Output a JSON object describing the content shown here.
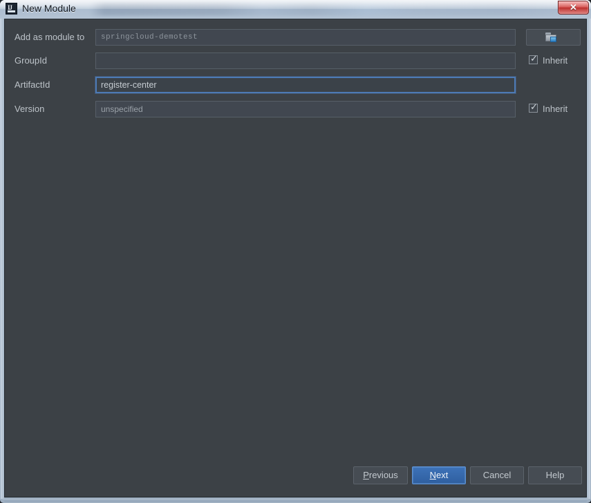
{
  "window": {
    "title": "New Module",
    "app_icon": "intellij-idea-icon",
    "close_label": "✕"
  },
  "form": {
    "rows": [
      {
        "label": "Add as module to",
        "value": "springcloud-demotest",
        "type": "text-disabled",
        "browse_icon": "folder-browse-icon"
      },
      {
        "label": "GroupId",
        "value": "",
        "type": "text-disabled",
        "inherit_label": "Inherit",
        "inherit_checked": true
      },
      {
        "label": "ArtifactId",
        "value": "register-center",
        "type": "text-focused"
      },
      {
        "label": "Version",
        "value": "unspecified",
        "type": "text-disabled",
        "inherit_label": "Inherit",
        "inherit_checked": true
      }
    ]
  },
  "footer": {
    "previous": {
      "prefix": "",
      "mnemonic": "P",
      "suffix": "revious"
    },
    "next": {
      "prefix": "",
      "mnemonic": "N",
      "suffix": "ext"
    },
    "cancel": {
      "label": "Cancel"
    },
    "help": {
      "label": "Help"
    }
  },
  "colors": {
    "dialog_background": "#3c4146",
    "field_border": "#575f68",
    "focus_border": "#4d7ab5",
    "default_button": "#3d72b8",
    "label_text": "#bdc3c9",
    "titlebar_start": "#b9c8d9",
    "close_button": "#d04744"
  }
}
